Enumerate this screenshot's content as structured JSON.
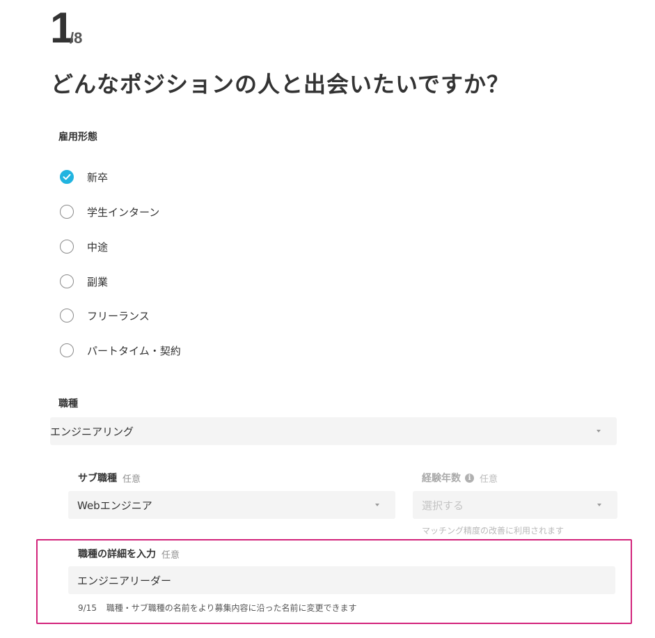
{
  "step": {
    "current": "1",
    "total": "/8"
  },
  "heading": "どんなポジションの人と出会いたいですか？",
  "employment": {
    "label": "雇用形態",
    "options": [
      {
        "label": "新卒",
        "checked": true
      },
      {
        "label": "学生インターン",
        "checked": false
      },
      {
        "label": "中途",
        "checked": false
      },
      {
        "label": "副業",
        "checked": false
      },
      {
        "label": "フリーランス",
        "checked": false
      },
      {
        "label": "パートタイム・契約",
        "checked": false
      }
    ]
  },
  "job_type": {
    "label": "職種",
    "value": "エンジニアリング"
  },
  "sub_job_type": {
    "label": "サブ職種",
    "optional": "任意",
    "value": "Webエンジニア"
  },
  "experience": {
    "label": "経験年数",
    "optional": "任意",
    "placeholder": "選択する",
    "helper": "マッチング精度の改善に利用されます"
  },
  "job_detail": {
    "label": "職種の詳細を入力",
    "optional": "任意",
    "value": "エンジニアリーダー",
    "counter": "9/15",
    "hint": "職種・サブ職種の名前をより募集内容に沿った名前に変更できます"
  },
  "colors": {
    "accent": "#21b4e0",
    "highlight": "#d2237b",
    "field_bg": "#f4f4f4"
  }
}
